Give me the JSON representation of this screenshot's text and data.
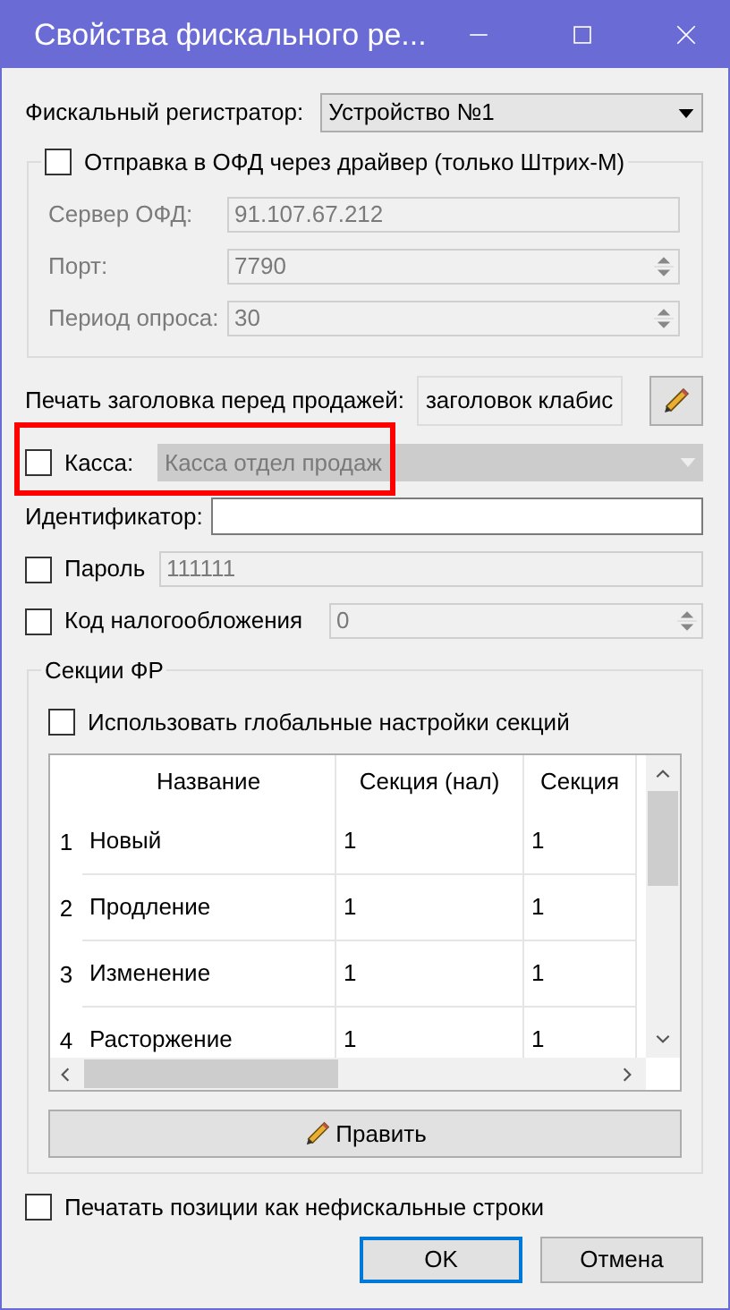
{
  "window": {
    "title": "Свойства фискального ре..."
  },
  "fiscal_registrar": {
    "label": "Фискальный регистратор:",
    "value": "Устройство №1"
  },
  "ofd_group": {
    "label": "Отправка в ОФД через драйвер (только Штрих-М)",
    "checked": false,
    "fields": [
      {
        "kind": "text",
        "label": "Сервер ОФД:",
        "value": "91.107.67.212"
      },
      {
        "kind": "spin",
        "label": "Порт:",
        "value": "7790"
      },
      {
        "kind": "spin",
        "label": "Период опроса:",
        "value": "30"
      }
    ]
  },
  "header_print": {
    "label": "Печать заголовка перед продажей:",
    "value": "заголовок клабис"
  },
  "kassa": {
    "label": "Касса:",
    "checked": false,
    "value": "Касса отдел продаж",
    "highlighted": true
  },
  "identifier": {
    "label": "Идентификатор:"
  },
  "password": {
    "label": "Пароль",
    "checked": false,
    "value": "111111"
  },
  "tax_code": {
    "label": "Код налогообложения",
    "checked": false,
    "value": "0"
  },
  "sections": {
    "title": "Секции ФР",
    "use_global": {
      "label": "Использовать глобальные настройки секций",
      "checked": false
    },
    "table": {
      "columns": [
        "Название",
        "Секция (нал)",
        "Секция"
      ],
      "rows": [
        {
          "number": "1",
          "cells": [
            "Новый",
            "1",
            "1"
          ]
        },
        {
          "number": "2",
          "cells": [
            "Продление",
            "1",
            "1"
          ]
        },
        {
          "number": "3",
          "cells": [
            "Изменение",
            "1",
            "1"
          ]
        },
        {
          "number": "4",
          "cells": [
            "Расторжение",
            "1",
            "1"
          ]
        }
      ]
    },
    "edit_button": "Править"
  },
  "print_nonfiscal": {
    "label": "Печатать позиции как нефискальные строки",
    "checked": false
  },
  "buttons": [
    {
      "label": "OK",
      "default": true
    },
    {
      "label": "Отмена",
      "default": false
    }
  ]
}
